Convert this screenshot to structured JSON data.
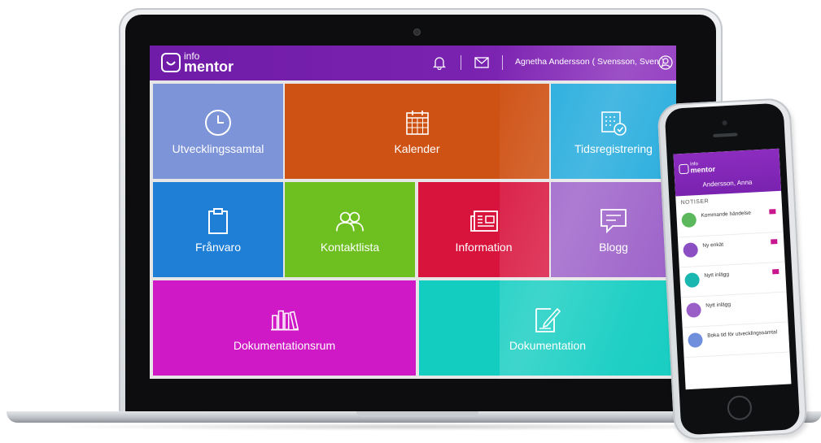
{
  "app": {
    "logo_small": "info",
    "logo_large": "mentor",
    "user_name": "Agnetha Andersson ( Svensson, Sven )"
  },
  "header_icons": [
    "bell-icon",
    "mail-icon",
    "user-circle-icon"
  ],
  "tiles": [
    {
      "label": "Utvecklingssamtal",
      "icon": "clock-icon",
      "color": "#7e94d9"
    },
    {
      "label": "Kalender",
      "icon": "calendar-icon",
      "color": "#cf5215"
    },
    {
      "label": "Tidsregistrering",
      "icon": "time-calendar-icon",
      "color": "#1ea9dc"
    },
    {
      "label": "Frånvaro",
      "icon": "clipboard-icon",
      "color": "#1f7fd6"
    },
    {
      "label": "Kontaktlista",
      "icon": "contacts-icon",
      "color": "#6dc01f"
    },
    {
      "label": "Information",
      "icon": "newspaper-icon",
      "color": "#d8143d"
    },
    {
      "label": "Blogg",
      "icon": "comment-icon",
      "color": "#9b5fc8"
    },
    {
      "label": "Dokumentationsrum",
      "icon": "books-icon",
      "color": "#cf19c6"
    },
    {
      "label": "Dokumentation",
      "icon": "document-edit-icon",
      "color": "#14cdc1"
    }
  ],
  "phone": {
    "logo_small": "info",
    "logo_large": "mentor",
    "user_name": "Andersson, Anna",
    "section": "NOTISER",
    "notifications": [
      {
        "title": "Kommande händelse",
        "time": "",
        "color": "#5cb85c"
      },
      {
        "title": "Ny enkät",
        "time": "",
        "color": "#8b4fc3"
      },
      {
        "title": "Nytt inlägg",
        "time": "",
        "color": "#19b7b0"
      },
      {
        "title": "Nytt inlägg",
        "time": "",
        "color": "#9b5fc8"
      },
      {
        "title": "Boka tid för utvecklingssamtal",
        "time": "",
        "color": "#6f8fdc"
      }
    ],
    "footer": ""
  },
  "colors": {
    "header": "#7a22b0",
    "brand_purple": "#7a22b0"
  }
}
